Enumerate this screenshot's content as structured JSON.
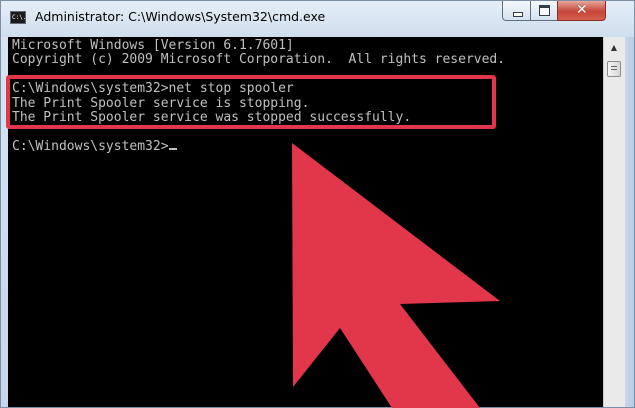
{
  "window": {
    "title": "Administrator: C:\\Windows\\System32\\cmd.exe",
    "icon_text": "C:\\."
  },
  "console": {
    "lines": [
      "Microsoft Windows [Version 6.1.7601]",
      "Copyright (c) 2009 Microsoft Corporation.  All rights reserved.",
      "",
      "C:\\Windows\\system32>net stop spooler",
      "The Print Spooler service is stopping.",
      "The Print Spooler service was stopped successfully.",
      "",
      "C:\\Windows\\system32>"
    ]
  },
  "icons": {
    "app": "cmd-icon",
    "minimize": "minimize-icon",
    "maximize": "maximize-icon",
    "close": "close-icon",
    "scroll_up": "scroll-up-arrow-icon",
    "annotation_arrow": "red-pointer-arrow-icon"
  },
  "colors": {
    "console_bg": "#000000",
    "console_fg": "#c0c0c0",
    "annotation": "#e2374a",
    "close_button": "#c7453a"
  }
}
